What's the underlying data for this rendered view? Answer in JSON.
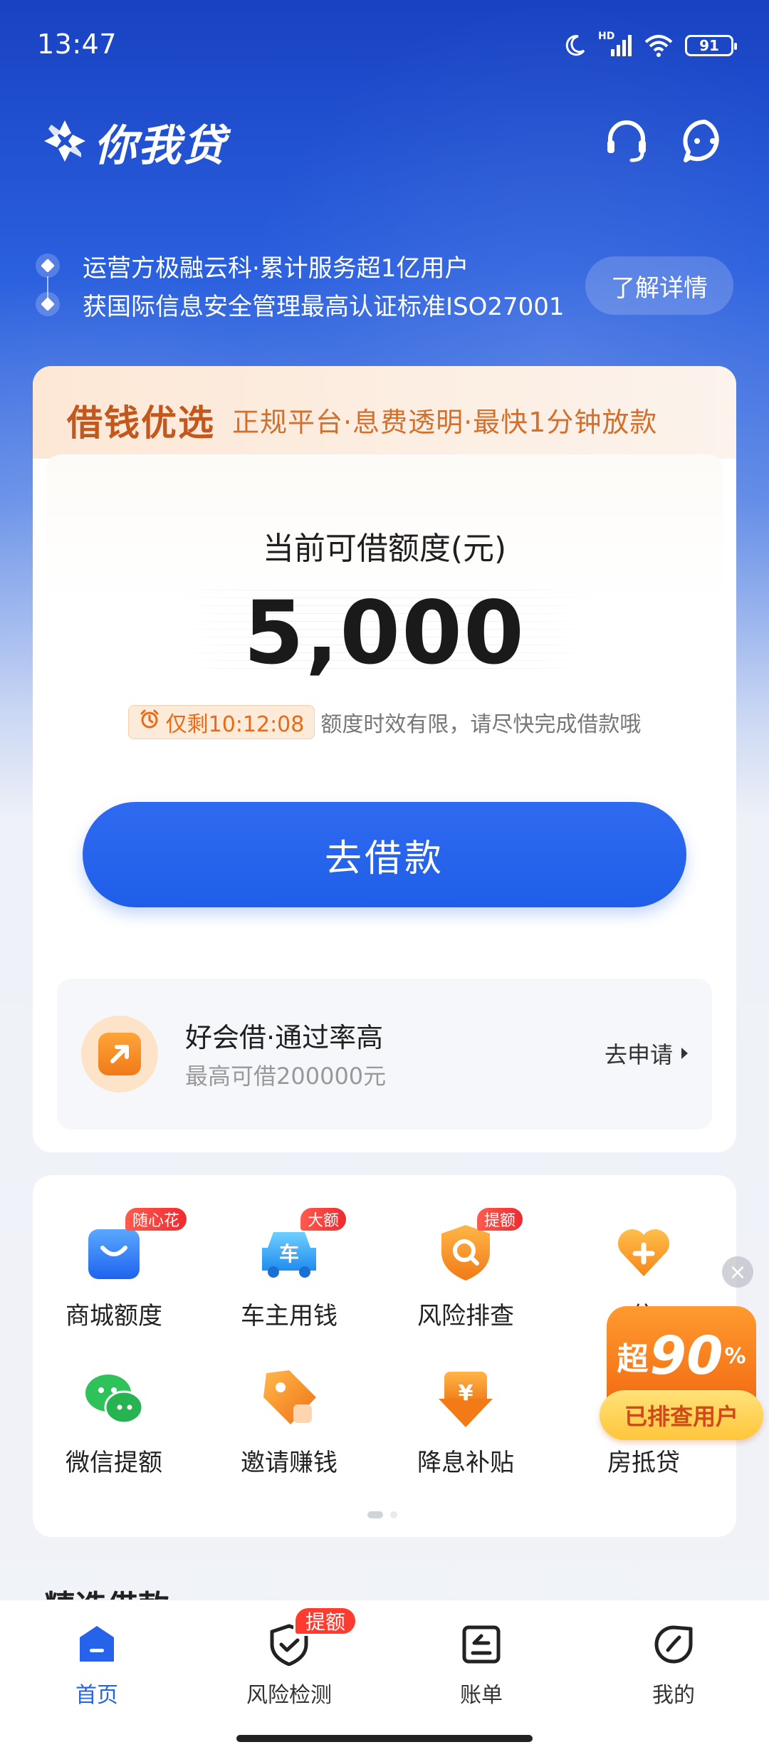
{
  "status_bar": {
    "time": "13:47",
    "network": "HD",
    "battery": "91",
    "icons": [
      "moon-icon",
      "signal-icon",
      "wifi-icon",
      "battery-icon"
    ]
  },
  "header": {
    "app_name": "你我贷",
    "icons": [
      "logo-icon",
      "headset-icon",
      "chat-icon"
    ]
  },
  "info": {
    "line1": "运营方极融云科·累计服务超1亿用户",
    "line2": "获国际信息安全管理最高认证标准ISO27001",
    "learn_more": "了解详情"
  },
  "loan_card": {
    "title": "借钱优选",
    "subtitle": "正规平台·息费透明·最快1分钟放款",
    "quota_label": "当前可借额度(元)",
    "quota_amount": "5,000",
    "timer": "仅剩10:12:08",
    "timer_note": "额度时效有限，请尽快完成借款哦",
    "borrow_button": "去借款",
    "promo": {
      "title": "好会借·通过率高",
      "subtitle": "最高可借200000元",
      "action": "去申请"
    }
  },
  "services": [
    {
      "label": "商城额度",
      "badge": "随心花",
      "icon": "shopping-bag-icon"
    },
    {
      "label": "车主用钱",
      "badge": "大额",
      "icon": "car-icon"
    },
    {
      "label": "风险排查",
      "badge": "提额",
      "icon": "shield-search-icon"
    },
    {
      "label": "信",
      "badge": "",
      "icon": "heart-plus-icon"
    },
    {
      "label": "微信提额",
      "badge": "",
      "icon": "wechat-icon"
    },
    {
      "label": "邀请赚钱",
      "badge": "",
      "icon": "tag-icon"
    },
    {
      "label": "降息补贴",
      "badge": "",
      "icon": "yuan-shield-icon"
    },
    {
      "label": "房抵贷",
      "badge": "",
      "icon": "house-icon"
    }
  ],
  "float_promo": {
    "pre": "超",
    "value": "90",
    "unit": "%",
    "caption": "已排查用户",
    "close": "×"
  },
  "section_peek": "精选借款",
  "nav": [
    {
      "label": "首页",
      "icon": "home-icon",
      "active": true,
      "badge": ""
    },
    {
      "label": "风险检测",
      "icon": "shield-check-icon",
      "active": false,
      "badge": "提额"
    },
    {
      "label": "账单",
      "icon": "bill-icon",
      "active": false,
      "badge": ""
    },
    {
      "label": "我的",
      "icon": "profile-icon",
      "active": false,
      "badge": ""
    }
  ],
  "colors": {
    "brand_blue": "#2563eb",
    "header_blue": "#1842c2",
    "orange_accent": "#e86a16",
    "badge_red": "#ff3b30"
  }
}
